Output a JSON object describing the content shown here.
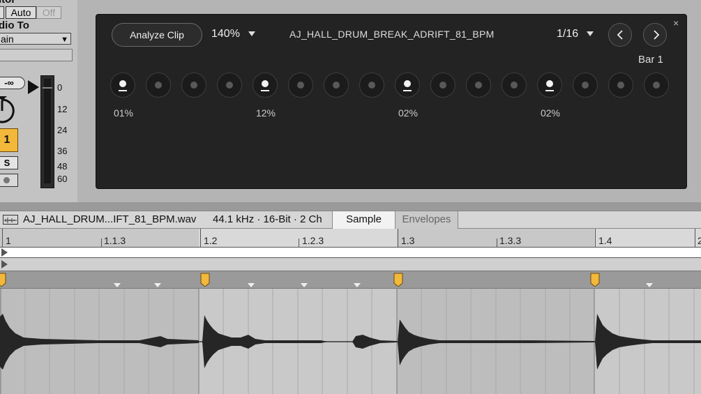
{
  "mixer": {
    "monitor_label": "itor",
    "monitor_buttons": [
      "Auto",
      "Off"
    ],
    "audio_to_label": "dio To",
    "audio_to_value": "ain",
    "send_value": "-∞",
    "meter_scale": [
      "0",
      "12",
      "24",
      "36",
      "48",
      "60"
    ],
    "track_number": "1",
    "solo_label": "S"
  },
  "device": {
    "analyze_label": "Analyze Clip",
    "zoom": "140%",
    "clip_name": "AJ_HALL_DRUM_BREAK_ADRIFT_81_BPM",
    "grid": "1/16",
    "bar_label": "Bar 1",
    "close": "×",
    "steps": [
      true,
      false,
      false,
      false,
      true,
      false,
      false,
      false,
      true,
      false,
      false,
      false,
      true,
      false,
      false,
      false
    ],
    "step_percents": [
      "01%",
      "12%",
      "02%",
      "02%"
    ]
  },
  "clip": {
    "filename": "AJ_HALL_DRUM...IFT_81_BPM.wav",
    "fileinfo": "44.1 kHz · 16-Bit · 2 Ch",
    "tab_sample": "Sample",
    "tab_envelopes": "Envelopes",
    "ruler_labels": [
      "1",
      "1.1.3",
      "1.2",
      "1.2.3",
      "1.3",
      "1.3.3",
      "1.4",
      "2"
    ]
  },
  "colors": {
    "warp_marker": "#f2b83a",
    "device_bg": "#232323"
  },
  "icons": {
    "prev": "chevron-left-icon",
    "next": "chevron-right-icon",
    "close": "close-icon",
    "waveform": "waveform-icon"
  }
}
